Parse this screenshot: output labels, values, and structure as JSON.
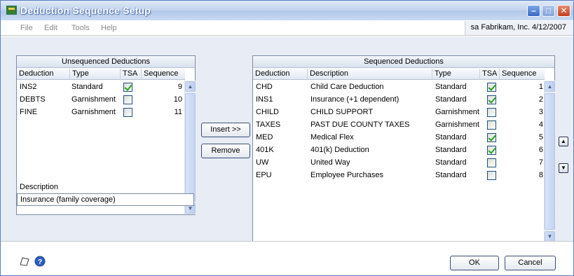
{
  "window": {
    "title": "Deduction Sequence Setup"
  },
  "menu": [
    "File",
    "Edit",
    "Tools",
    "Help"
  ],
  "company_info": "sa  Fabrikam, Inc.  4/12/2007",
  "unsequenced": {
    "title": "Unsequenced Deductions",
    "columns": [
      "Deduction",
      "Type",
      "TSA",
      "Sequence"
    ],
    "rows": [
      {
        "deduction": "INS2",
        "type": "Standard",
        "tsa": true,
        "sequence": "9"
      },
      {
        "deduction": "DEBTS",
        "type": "Garnishment",
        "tsa": false,
        "sequence": "10"
      },
      {
        "deduction": "FINE",
        "type": "Garnishment",
        "tsa": false,
        "sequence": "11"
      }
    ]
  },
  "buttons": {
    "insert": "Insert >>",
    "remove": "Remove",
    "ok": "OK",
    "cancel": "Cancel"
  },
  "description": {
    "label": "Description",
    "value": "Insurance (family coverage)"
  },
  "sequenced": {
    "title": "Sequenced Deductions",
    "columns": [
      "Deduction",
      "Description",
      "Type",
      "TSA",
      "Sequence"
    ],
    "rows": [
      {
        "deduction": "CHD",
        "description": "Child Care Deduction",
        "type": "Standard",
        "tsa": true,
        "sequence": "1"
      },
      {
        "deduction": "INS1",
        "description": "Insurance (+1 dependent)",
        "type": "Standard",
        "tsa": true,
        "sequence": "2"
      },
      {
        "deduction": "CHILD",
        "description": "CHILD SUPPORT",
        "type": "Garnishment",
        "tsa": false,
        "sequence": "3"
      },
      {
        "deduction": "TAXES",
        "description": "PAST DUE COUNTY TAXES",
        "type": "Garnishment",
        "tsa": false,
        "sequence": "4"
      },
      {
        "deduction": "MED",
        "description": "Medical Flex",
        "type": "Standard",
        "tsa": true,
        "sequence": "5"
      },
      {
        "deduction": "401K",
        "description": "401(k) Deduction",
        "type": "Standard",
        "tsa": true,
        "sequence": "6"
      },
      {
        "deduction": "UW",
        "description": "United Way",
        "type": "Standard",
        "tsa": false,
        "sequence": "7"
      },
      {
        "deduction": "EPU",
        "description": "Employee Purchases",
        "type": "Standard",
        "tsa": false,
        "sequence": "8"
      }
    ]
  },
  "icons": {
    "app": "window-app-icon",
    "move_up": "move-up-icon",
    "move_down": "move-down-icon",
    "note": "note-icon",
    "help": "help-icon"
  }
}
